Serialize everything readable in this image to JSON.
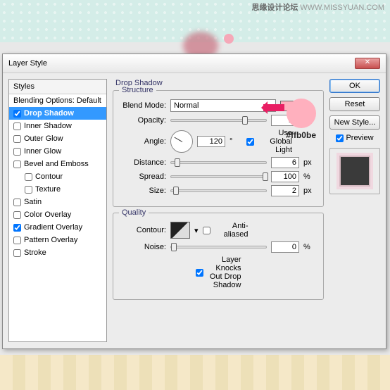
{
  "watermark": {
    "chinese": "思缘设计论坛",
    "url": "WWW.MISSYUAN.COM"
  },
  "dialog": {
    "title": "Layer Style"
  },
  "styles_header": "Styles",
  "styles": [
    {
      "label": "Blending Options: Default",
      "checked": null
    },
    {
      "label": "Drop Shadow",
      "checked": true,
      "selected": true
    },
    {
      "label": "Inner Shadow",
      "checked": false
    },
    {
      "label": "Outer Glow",
      "checked": false
    },
    {
      "label": "Inner Glow",
      "checked": false
    },
    {
      "label": "Bevel and Emboss",
      "checked": false
    },
    {
      "label": "Contour",
      "checked": false,
      "sub": true
    },
    {
      "label": "Texture",
      "checked": false,
      "sub": true
    },
    {
      "label": "Satin",
      "checked": false
    },
    {
      "label": "Color Overlay",
      "checked": false
    },
    {
      "label": "Gradient Overlay",
      "checked": true
    },
    {
      "label": "Pattern Overlay",
      "checked": false
    },
    {
      "label": "Stroke",
      "checked": false
    }
  ],
  "section_title": "Drop Shadow",
  "structure": {
    "legend": "Structure",
    "blend_mode_label": "Blend Mode:",
    "blend_mode_value": "Normal",
    "opacity_label": "Opacity:",
    "opacity_value": "75",
    "opacity_unit": "%",
    "angle_label": "Angle:",
    "angle_value": "120",
    "angle_unit": "°",
    "global_light_label": "Use Global Light",
    "global_light_checked": true,
    "distance_label": "Distance:",
    "distance_value": "6",
    "distance_unit": "px",
    "spread_label": "Spread:",
    "spread_value": "100",
    "spread_unit": "%",
    "size_label": "Size:",
    "size_value": "2",
    "size_unit": "px",
    "color": "#ffb0be"
  },
  "quality": {
    "legend": "Quality",
    "contour_label": "Contour:",
    "antialiased_label": "Anti-aliased",
    "antialiased_checked": false,
    "noise_label": "Noise:",
    "noise_value": "0",
    "noise_unit": "%",
    "knockout_label": "Layer Knocks Out Drop Shadow",
    "knockout_checked": true
  },
  "buttons": {
    "ok": "OK",
    "cancel": "Reset",
    "new_style": "New Style...",
    "preview": "Preview"
  },
  "preview_checked": true,
  "color_annotation": "#ffb0be"
}
